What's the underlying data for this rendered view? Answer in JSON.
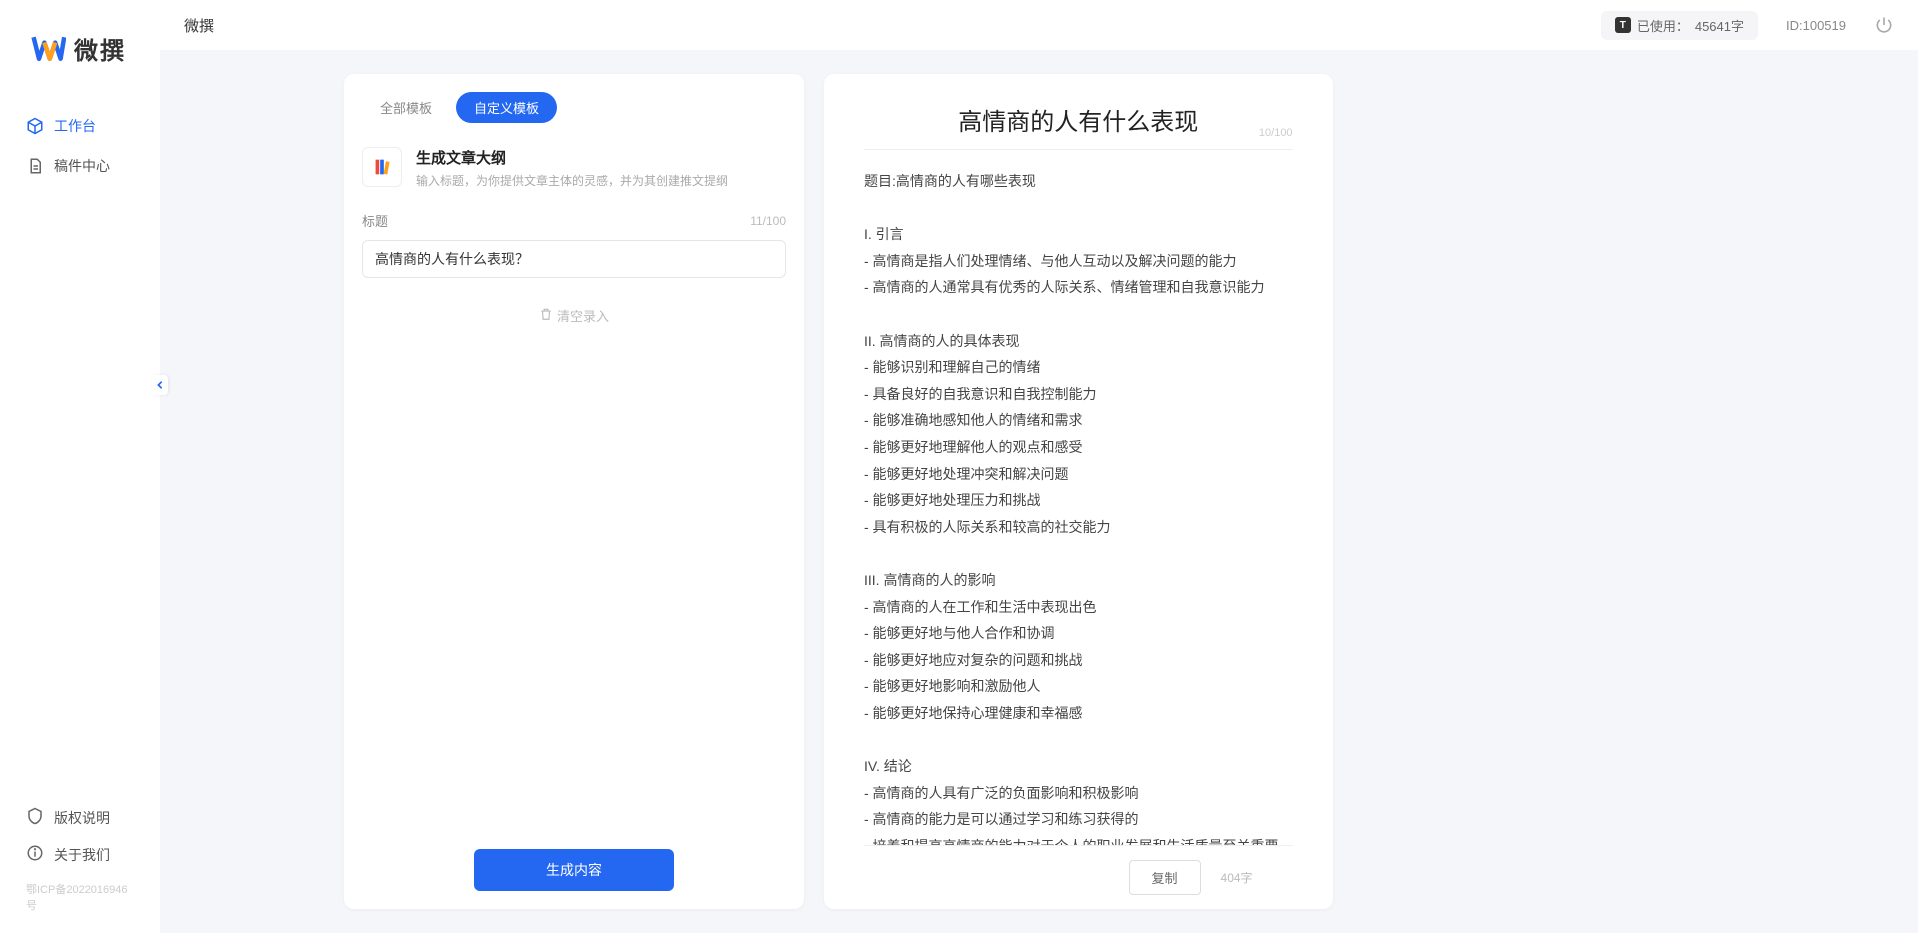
{
  "app": {
    "brand": "微撰",
    "header_title": "微撰",
    "usage_label": "已使用：",
    "usage_value": "45641字",
    "id_label": "ID:100519"
  },
  "sidebar": {
    "items": [
      {
        "label": "工作台",
        "active": true
      },
      {
        "label": "稿件中心",
        "active": false
      }
    ],
    "bottom": [
      {
        "label": "版权说明"
      },
      {
        "label": "关于我们"
      }
    ],
    "icp": "鄂ICP备2022016946号"
  },
  "left": {
    "tabs": [
      {
        "label": "全部模板",
        "active": false
      },
      {
        "label": "自定义模板",
        "active": true
      }
    ],
    "template": {
      "title": "生成文章大纲",
      "desc": "输入标题，为你提供文章主体的灵感，并为其创建推文提纲"
    },
    "form": {
      "label": "标题",
      "counter": "11/100",
      "value": "高情商的人有什么表现？",
      "clear": "清空录入"
    },
    "generate": "生成内容"
  },
  "right": {
    "title": "高情商的人有什么表现",
    "title_counter": "10/100",
    "body": "题目:高情商的人有哪些表现\n\nI. 引言\n- 高情商是指人们处理情绪、与他人互动以及解决问题的能力\n- 高情商的人通常具有优秀的人际关系、情绪管理和自我意识能力\n\nII. 高情商的人的具体表现\n- 能够识别和理解自己的情绪\n- 具备良好的自我意识和自我控制能力\n- 能够准确地感知他人的情绪和需求\n- 能够更好地理解他人的观点和感受\n- 能够更好地处理冲突和解决问题\n- 能够更好地处理压力和挑战\n- 具有积极的人际关系和较高的社交能力\n\nIII. 高情商的人的影响\n- 高情商的人在工作和生活中表现出色\n- 能够更好地与他人合作和协调\n- 能够更好地应对复杂的问题和挑战\n- 能够更好地影响和激励他人\n- 能够更好地保持心理健康和幸福感\n\nIV. 结论\n- 高情商的人具有广泛的负面影响和积极影响\n- 高情商的能力是可以通过学习和练习获得的\n- 培养和提高高情商的能力对于个人的职业发展和生活质量至关重要。",
    "copy": "复制",
    "wordcount": "404字"
  }
}
